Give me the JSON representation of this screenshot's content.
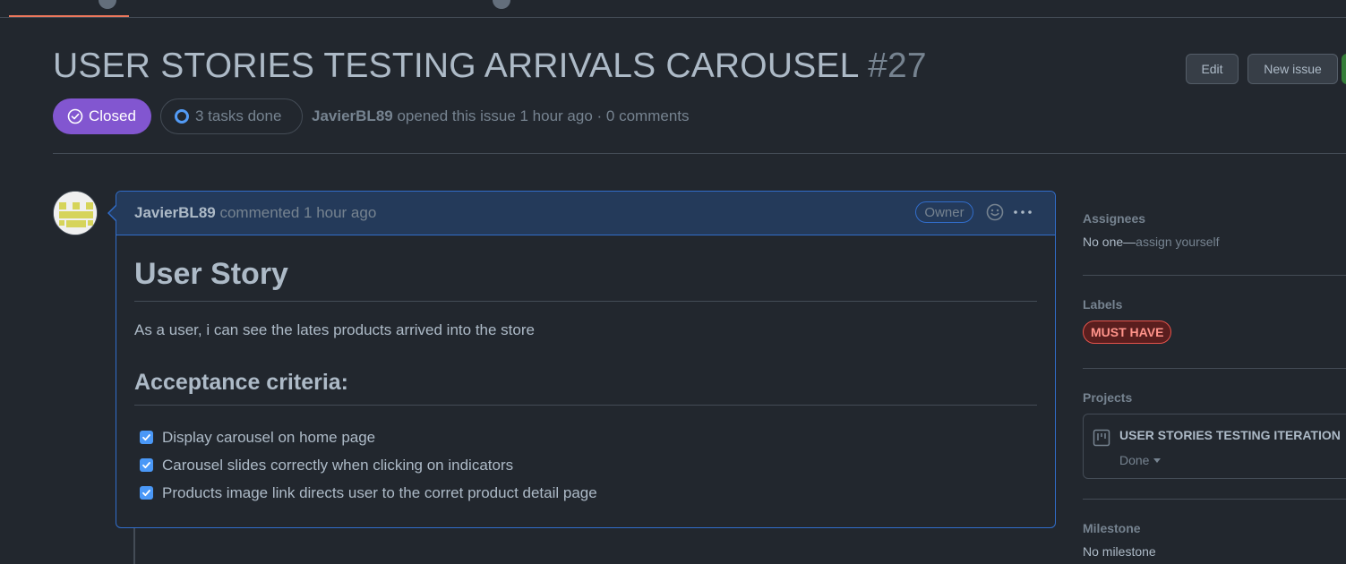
{
  "issue": {
    "title": "USER STORIES TESTING ARRIVALS CAROUSEL",
    "number": "#27",
    "state": "Closed",
    "tasks": "3 tasks done",
    "author": "JavierBL89",
    "opened_text": "opened this issue 1 hour ago · 0 comments"
  },
  "actions": {
    "edit_label": "Edit",
    "new_issue_label": "New issue"
  },
  "comment": {
    "author": "JavierBL89",
    "time_text": "commented 1 hour ago",
    "role_badge": "Owner",
    "heading": "User Story",
    "paragraph": "As a user, i can see the lates products arrived into the store",
    "subheading": "Acceptance criteria:",
    "tasks": [
      {
        "label": "Display carousel on home page",
        "checked": true
      },
      {
        "label": "Carousel slides correctly when clicking on indicators",
        "checked": true
      },
      {
        "label": "Products image link directs user to the corret product detail page",
        "checked": true
      }
    ]
  },
  "sidebar": {
    "assignees": {
      "heading": "Assignees",
      "value": "No one—",
      "action": "assign yourself"
    },
    "labels": {
      "heading": "Labels",
      "items": [
        "MUST HAVE"
      ]
    },
    "projects": {
      "heading": "Projects",
      "name": "USER STORIES TESTING ITERATION",
      "status": "Done"
    },
    "milestone": {
      "heading": "Milestone",
      "value": "No milestone"
    }
  },
  "colors": {
    "background": "#22272e",
    "closed_badge": "#8256d0",
    "comment_border": "#316dca",
    "label_must_have": "#e5534b",
    "tab_underline": "#ec775c"
  },
  "icons": {
    "state": "check-circle-icon",
    "tasks": "progress-ring-icon",
    "emoji": "smiley-icon",
    "menu": "kebab-horizontal-icon",
    "project": "project-board-icon"
  }
}
